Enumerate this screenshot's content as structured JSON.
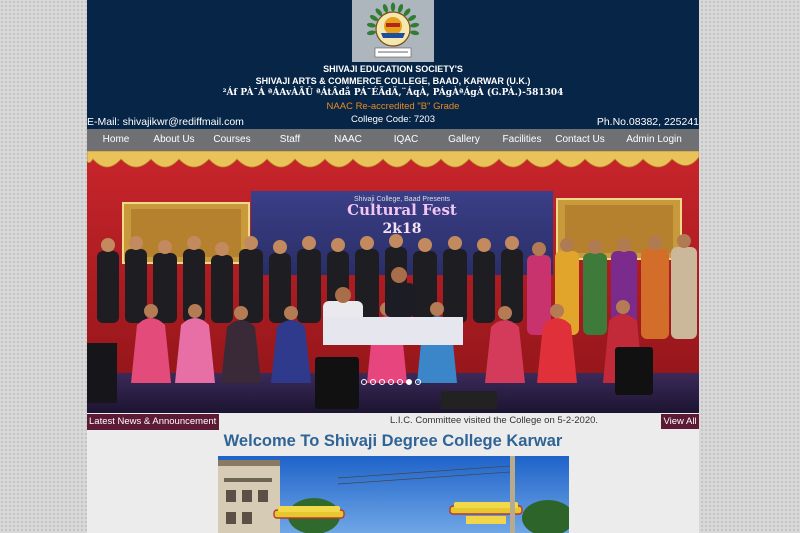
{
  "header": {
    "society": "SHIVAJI    EDUCATION   SOCIETY'S",
    "college": "SHIVAJI ARTS & COMMERCE COLLEGE, BAAD, KARWAR (U.K.)",
    "kannada": "²Áf PÀ¯Á ªÁAvÀÃÛ ªÁtÂdå PÁ¯ÉÃdÄ,¨ÁqÀ, PÁgÀªÁgÀ (G.PÀ.)-581304",
    "naac": "NAAC Re-accredited \"B\" Grade",
    "code": "College Code: 7203",
    "email": "E-Mail: shivajikwr@rediffmail.com",
    "phone": "Ph.No.08382, 225241"
  },
  "nav": {
    "items": [
      {
        "label": "Home"
      },
      {
        "label": "About Us"
      },
      {
        "label": "Courses"
      },
      {
        "label": "Staff"
      },
      {
        "label": "NAAC"
      },
      {
        "label": "IQAC"
      },
      {
        "label": "Gallery"
      },
      {
        "label": "Facilities"
      },
      {
        "label": "Contact Us"
      },
      {
        "label": "Admin Login"
      }
    ]
  },
  "slider": {
    "banner_line1": "Shivaji College, Baad Presents",
    "banner_line2": "Cultural Fest",
    "banner_line3": "2k18",
    "slide_count": 7,
    "active_slide": 5
  },
  "news": {
    "label": "Latest News & Announcement",
    "text": "L.I.C. Committee visited the College on 5-2-2020.",
    "view_all": "View All"
  },
  "welcome": {
    "title": "Welcome To Shivaji Degree College Karwar"
  },
  "colors": {
    "header_bg": "#072547",
    "naac_orange": "#e98b24",
    "nav_bg": "#6e7073",
    "news_maroon": "#5c1a34",
    "welcome_blue": "#2f6496"
  }
}
